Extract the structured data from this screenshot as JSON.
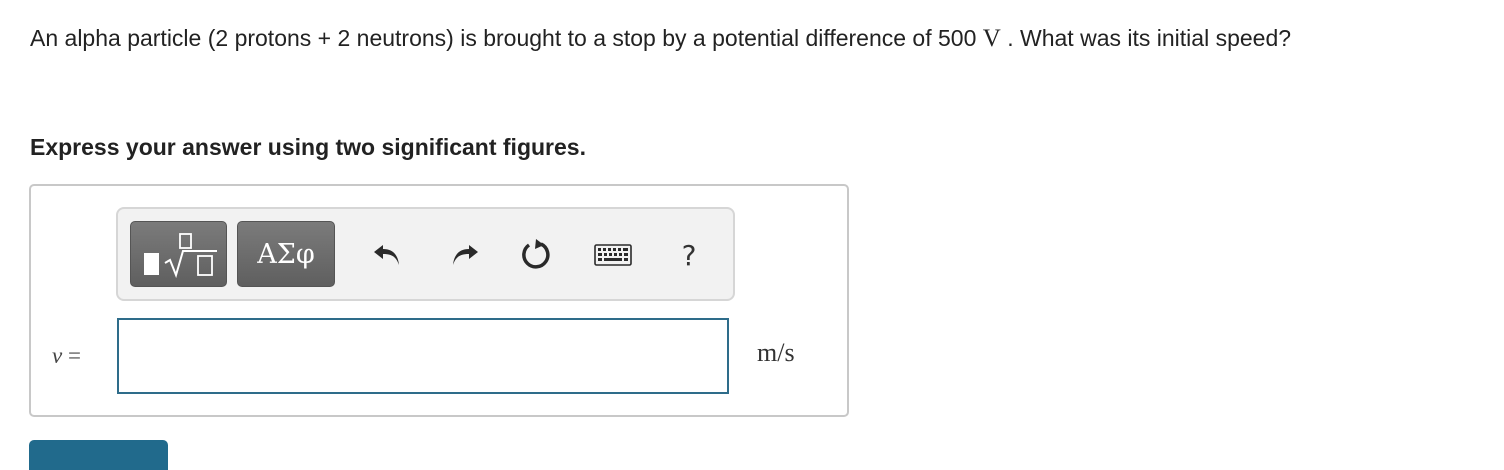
{
  "question": {
    "text_before": "An alpha particle (2 protons + 2 neutrons) is brought to a stop by a potential difference of 500 ",
    "unit_math": "V",
    "text_after": " . What was its initial speed?"
  },
  "instruction": "Express your answer using two significant figures.",
  "toolbar": {
    "templates_icon": "templates-radical-icon",
    "greek_label": "ΑΣφ",
    "undo_icon": "undo-icon",
    "redo_icon": "redo-icon",
    "reset_icon": "reset-icon",
    "keyboard_icon": "keyboard-icon",
    "help_label": "?"
  },
  "answer": {
    "variable": "v",
    "equals": " =",
    "value": "",
    "unit": "m/s"
  },
  "colors": {
    "accent": "#216a8c",
    "input_border": "#2e6c8a",
    "button_dark": "#6b6b6b"
  }
}
